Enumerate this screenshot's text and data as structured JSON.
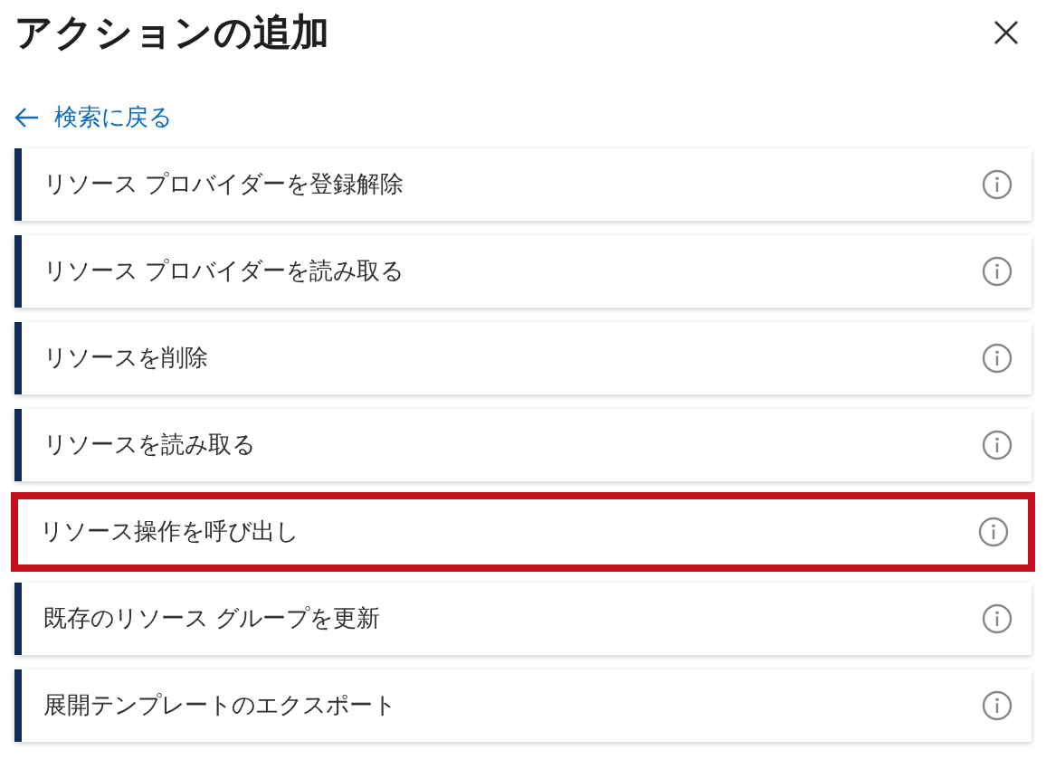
{
  "panel": {
    "title": "アクションの追加",
    "back_link": "検索に戻る"
  },
  "actions": [
    {
      "label": "リソース プロバイダーを登録解除",
      "highlighted": false
    },
    {
      "label": "リソース プロバイダーを読み取る",
      "highlighted": false
    },
    {
      "label": "リソースを削除",
      "highlighted": false
    },
    {
      "label": "リソースを読み取る",
      "highlighted": false
    },
    {
      "label": "リソース操作を呼び出し",
      "highlighted": true
    },
    {
      "label": "既存のリソース グループを更新",
      "highlighted": false
    },
    {
      "label": "展開テンプレートのエクスポート",
      "highlighted": false
    }
  ]
}
